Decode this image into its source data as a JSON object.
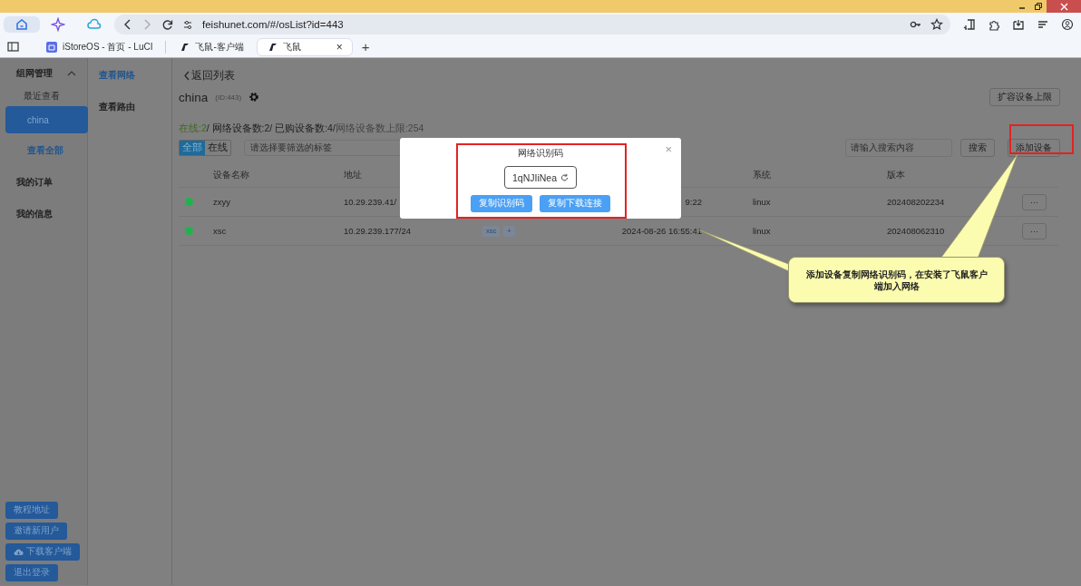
{
  "browser": {
    "toolbar_icons": [
      {
        "selected": true
      },
      {
        "selected": false
      },
      {
        "selected": false
      }
    ],
    "url": "feishunet.com/#/osList?id=443",
    "tabs": [
      {
        "label": "iStoreOS - 首页 - LuCI",
        "selected": false
      },
      {
        "label": "飞鼠-客户端",
        "selected": false
      },
      {
        "label": "飞鼠",
        "selected": true,
        "close": "×"
      }
    ],
    "new_tab": "+"
  },
  "sidebar": {
    "group": {
      "label": "组网管理",
      "expanded": true
    },
    "recent_label": "最近查看",
    "recent": [
      {
        "label": "china",
        "selected": true
      }
    ],
    "view_all": "查看全部",
    "items": [
      {
        "label": "我的订单"
      },
      {
        "label": "我的信息"
      }
    ],
    "buttons": [
      {
        "label": "教程地址",
        "kind": "plain"
      },
      {
        "label": "邀请新用户",
        "kind": "plain"
      },
      {
        "label": "下载客户端",
        "kind": "download"
      },
      {
        "label": "退出登录",
        "kind": "plain"
      }
    ]
  },
  "subnav": [
    {
      "label": "查看网络",
      "selected": true
    },
    {
      "label": "查看路由",
      "selected": false
    }
  ],
  "main": {
    "back": "返回列表",
    "network_name": "china",
    "network_id": "(ID:443)",
    "expand_button": "扩容设备上限",
    "stats": [
      {
        "text": "在线:2",
        "kind": "online"
      },
      {
        "text": "/ 网络设备数:2/ 已购设备数:4/",
        "kind": "normal"
      },
      {
        "text": "网络设备数上限:254",
        "kind": "limit"
      }
    ],
    "filters": [
      {
        "label": "全部",
        "selected": true
      },
      {
        "label": "在线",
        "selected": false
      }
    ],
    "tag_select": {
      "placeholder": "请选择要筛选的标签"
    },
    "search": {
      "placeholder": "请输入搜索内容"
    },
    "search_button": "搜索",
    "add_button": "添加设备",
    "table": {
      "columns": [
        "设备名称",
        "地址",
        "",
        "",
        "系统",
        "版本"
      ],
      "rows": [
        {
          "online": true,
          "name": "zxyy",
          "address": "10.29.239.41/",
          "tags": [],
          "time": "9:22",
          "os": "linux",
          "version": "202408202234",
          "action": "···"
        },
        {
          "online": true,
          "name": "xsc",
          "address": "10.29.239.177/24",
          "tags": [
            "xsc",
            "+"
          ],
          "time": "2024-08-26 16:55:41",
          "os": "linux",
          "version": "202408062310",
          "action": "···"
        }
      ]
    }
  },
  "modal": {
    "title": "网络识别码",
    "close": "×",
    "code": "1qNJIiNea",
    "buttons": [
      "复制识别码",
      "复制下载连接"
    ]
  },
  "callout": {
    "text": "添加设备复制网络识别码，在安装了飞鼠客户端加入网络"
  }
}
